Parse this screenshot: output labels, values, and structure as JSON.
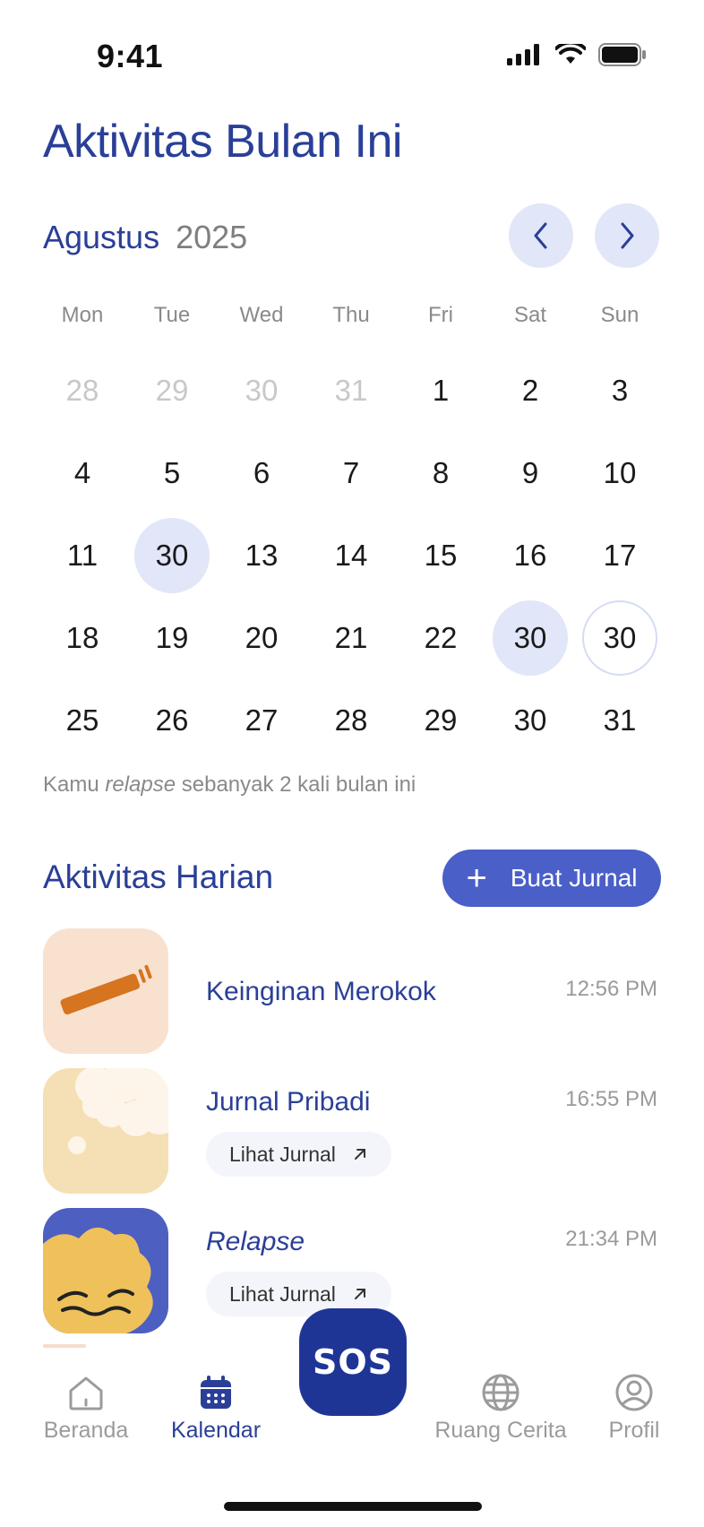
{
  "status_bar": {
    "time": "9:41"
  },
  "header": {
    "title": "Aktivitas Bulan Ini"
  },
  "calendar": {
    "month": "Agustus",
    "year": "2025",
    "prev_icon": "chevron-left-icon",
    "next_icon": "chevron-right-icon",
    "weekdays": [
      "Mon",
      "Tue",
      "Wed",
      "Thu",
      "Fri",
      "Sat",
      "Sun"
    ],
    "weeks": [
      [
        "28",
        "29",
        "30",
        "31",
        "1",
        "2",
        "3"
      ],
      [
        "4",
        "5",
        "6",
        "7",
        "8",
        "9",
        "10"
      ],
      [
        "11",
        "30",
        "13",
        "14",
        "15",
        "16",
        "17"
      ],
      [
        "18",
        "19",
        "20",
        "21",
        "22",
        "30",
        "30"
      ],
      [
        "25",
        "26",
        "27",
        "28",
        "29",
        "30",
        "31"
      ]
    ],
    "accent_color": "#2a3f97",
    "highlight_color": "#e1e6f8"
  },
  "relapse_note": {
    "prefix": "Kamu ",
    "emphasis": "relapse",
    "suffix": " sebanyak 2 kali bulan ini"
  },
  "daily": {
    "title": "Aktivitas Harian",
    "create_button": "Buat Jurnal",
    "items": [
      {
        "title": "Keinginan Merokok",
        "time": "12:56 PM",
        "icon": "cigarette-icon"
      },
      {
        "title": "Jurnal Pribadi",
        "time": "16:55 PM",
        "link": "Lihat Jurnal",
        "icon": "thought-cloud-icon"
      },
      {
        "title": "Relapse",
        "time": "21:34 PM",
        "link": "Lihat Jurnal",
        "icon": "sad-face-icon"
      }
    ]
  },
  "bottom_nav": {
    "items": [
      {
        "label": "Beranda",
        "icon": "home-icon"
      },
      {
        "label": "Kalendar",
        "icon": "calendar-icon",
        "active": true
      },
      {
        "label": "Ruang Cerita",
        "icon": "globe-icon"
      },
      {
        "label": "Profil",
        "icon": "profile-icon"
      }
    ],
    "sos_label": "SOS"
  }
}
